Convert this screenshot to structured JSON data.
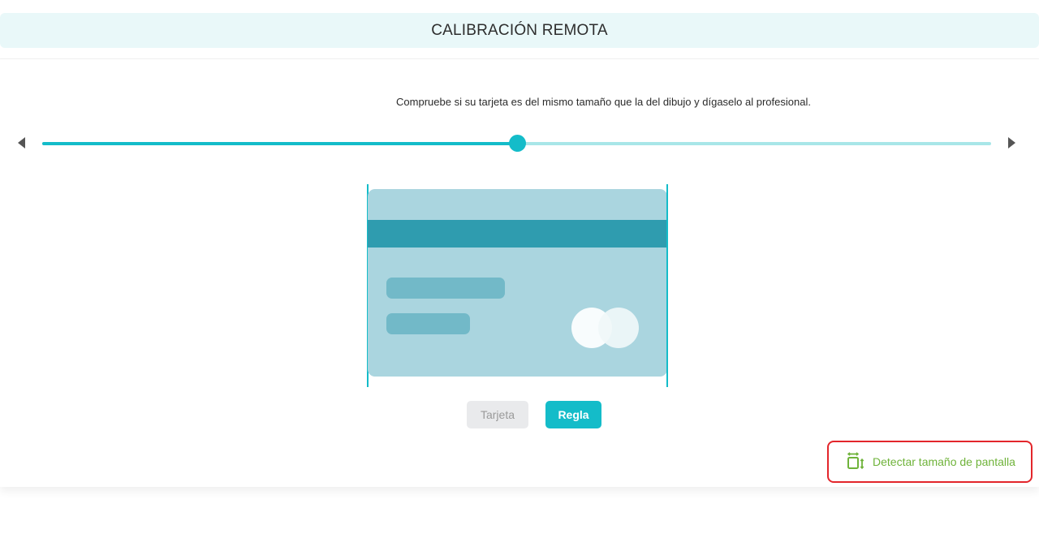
{
  "header": {
    "title": "CALIBRACIÓN REMOTA"
  },
  "instruction": "Compruebe si su tarjeta es del mismo tamaño que la del dibujo y dígaselo al profesional.",
  "slider": {
    "value_fraction": 0.5
  },
  "buttons": {
    "tarjeta_label": "Tarjeta",
    "regla_label": "Regla"
  },
  "detect": {
    "label": "Detectar tamaño de pantalla",
    "icon": "screen-resize-icon"
  },
  "colors": {
    "accent": "#14bcc9",
    "detect_text": "#6fb33a",
    "highlight_border": "#e3262b"
  }
}
